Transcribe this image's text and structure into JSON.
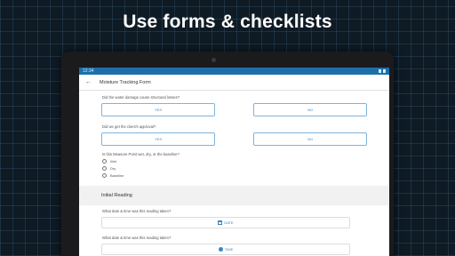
{
  "headline": "Use forms & checklists",
  "status_bar": {
    "time": "12:34"
  },
  "app_bar": {
    "title": "Moisture Tracking Form",
    "back_icon": "arrow-left-icon"
  },
  "questions": {
    "structural": {
      "label": "Did the water damage cause structural losses?",
      "yes": "YES",
      "no": "NO"
    },
    "approval": {
      "label": "Did we get the client's approval?",
      "yes": "YES",
      "no": "NO"
    },
    "measure_point": {
      "label": "Is this Measure Point wet, dry, or the baseline?",
      "options": [
        "Wet",
        "Dry",
        "Baseline"
      ]
    }
  },
  "initial_reading": {
    "heading": "Initial Reading",
    "date_question": "What date & time was this reading taken?",
    "date_button": "DATE",
    "time_question": "What date & time was this reading taken?",
    "time_button": "TIME"
  },
  "colors": {
    "accent": "#3b86c0",
    "status_bar": "#1d6fa8",
    "background": "#0e1a24"
  }
}
